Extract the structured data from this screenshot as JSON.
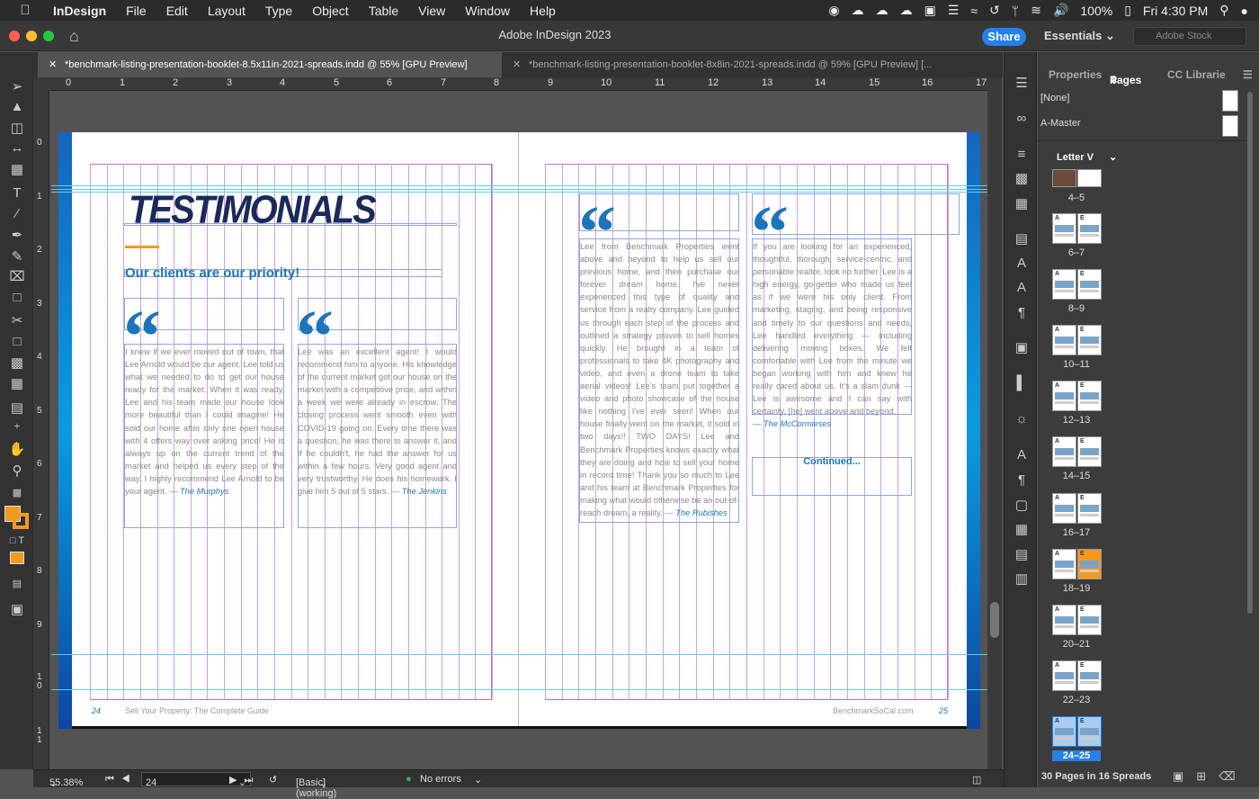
{
  "menubar": {
    "app": "InDesign",
    "items": [
      "File",
      "Edit",
      "Layout",
      "Type",
      "Object",
      "Table",
      "View",
      "Window",
      "Help"
    ],
    "battery": "100%",
    "clock": "Fri 4:30 PM"
  },
  "window": {
    "title": "Adobe InDesign 2023",
    "share": "Share",
    "workspace": "Essentials",
    "stock_placeholder": "Adobe Stock"
  },
  "tabs": [
    {
      "label": "*benchmark-listing-presentation-booklet-8.5x11in-2021-spreads.indd @ 55% [GPU Preview]",
      "active": true
    },
    {
      "label": "*benchmark-listing-presentation-booklet-8x8in-2021-spreads.indd @ 59% [GPU Preview] [..."
    }
  ],
  "ruler": {
    "h": [
      "0",
      "1",
      "2",
      "3",
      "4",
      "5",
      "6",
      "7",
      "8",
      "9",
      "10",
      "11",
      "12",
      "13",
      "14",
      "15",
      "16",
      "17"
    ],
    "v": [
      "0",
      "1",
      "2",
      "3",
      "4",
      "5",
      "6",
      "7",
      "8",
      "9",
      "1 0",
      "1 1"
    ]
  },
  "status": {
    "zoom": "55.38%",
    "page": "24",
    "style": "[Basic] (working)",
    "preflight": "No errors"
  },
  "panel": {
    "tabs": [
      "Properties",
      "Pages",
      "CC Librarie"
    ],
    "masters": [
      "[None]",
      "A-Master"
    ],
    "spread_master": "Letter V",
    "spreads": [
      "4–5",
      "6–7",
      "8–9",
      "10–11",
      "12–13",
      "14–15",
      "16–17",
      "18–19",
      "20–21",
      "22–23",
      "24–25"
    ],
    "footer": "30 Pages in 16 Spreads"
  },
  "doc": {
    "title": "TESTIMONIALS",
    "subtitle": "Our clients are our priority!",
    "quote_mark": "“",
    "t1": {
      "text": "I knew if we ever moved out of town, that Lee Arnold would be our agent. Lee told us what we needed to do to get our house ready for the market. When it was ready, Lee and his team made our house look more beautiful than I could imagine! He sold our home after only one open house with 4 offers way over asking price! He is always up on the current trend of the market and helped us every step of the way. I highly recommend Lee Arnold to be your agent. — ",
      "by": "The Murphys"
    },
    "t2": {
      "text": "Lee was an excellent agent! I would recommend him to anyone. His knowledge of the current market got our house on the market with a competitive price, and within a week we were already in escrow. The closing process went smooth even with COVID-19 going on. Every time there was a question, he was there to answer it, and if he couldn't, he had the answer for us within a few hours. Very good agent and very trustworthy. He does his homework. I give him 5 out of 5 stars. — ",
      "by": "The Jenkins"
    },
    "t3": {
      "text": "Lee from Benchmark Properties went above and beyond to help us sell our previous home, and then purchase our forever dream home. I've never experienced this type of quality and service from a realty company. Lee guided us through each step of the process and outlined a strategy proven to sell homes quickly. He brought in a team of professionals to take 4K photography and video, and even a drone team to take aerial videos! Lee's team put together a video and photo showcase of the house like nothing I've ever seen! When our house finally went on the market, it sold in two days!! TWO DAYS! Lee and Benchmark Properties knows exactly what they are doing and how to sell your home in record time! Thank you so much to Lee and his team at Benchmark Properties for making what would otherwise be an out-of-reach dream, a reality. — ",
      "by": "The Rubishes"
    },
    "t4": {
      "text": "If you are looking for an experienced, thoughtful, thorough, service-centric, and personable realtor, look no further. Lee is a high energy, go-getter who made us feel as if we were his only client. From marketing, staging, and being responsive and timely to our questions and needs, Lee handled everything — including delivering moving boxes. We felt comfortable with Lee from the minute we began working with him and knew he really cared about us. It's a slam dunk — Lee is awesome and I can say with certainty, [he] went above and beyond.",
      "by": "— The McCormieses"
    },
    "continued": "Continued...",
    "footer_left_num": "24",
    "footer_left": "Sell Your Property: The Complete Guide",
    "footer_right": "BenchmarkSoCal.com",
    "footer_right_num": "25"
  }
}
